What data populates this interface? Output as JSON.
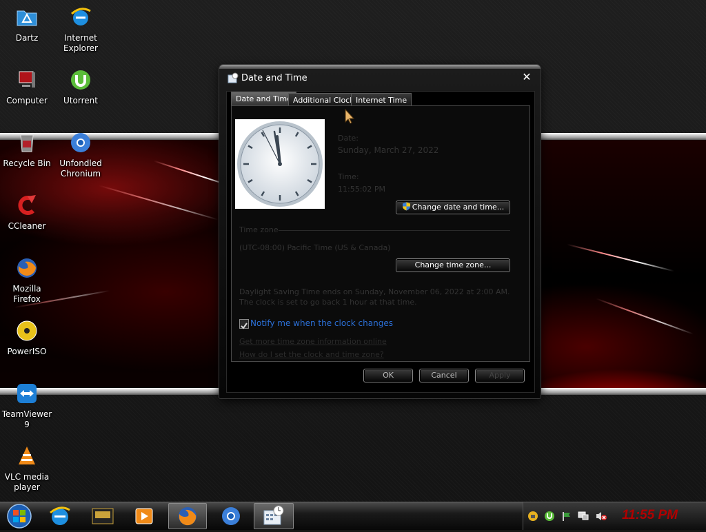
{
  "desktop_icons": [
    {
      "label": "Dartz",
      "icon": "dartz-folder-icon"
    },
    {
      "label": "Internet Explorer",
      "icon": "internet-explorer-icon"
    },
    {
      "label": "Computer",
      "icon": "computer-icon"
    },
    {
      "label": "Utorrent",
      "icon": "utorrent-icon"
    },
    {
      "label": "Recycle Bin",
      "icon": "recycle-bin-icon"
    },
    {
      "label": "Unfondled Chronium",
      "icon": "chromium-icon"
    },
    {
      "label": "CCleaner",
      "icon": "ccleaner-icon"
    },
    {
      "label": "Mozilla Firefox",
      "icon": "firefox-icon"
    },
    {
      "label": "PowerISO",
      "icon": "poweriso-icon"
    },
    {
      "label": "TeamViewer 9",
      "icon": "teamviewer-icon"
    },
    {
      "label": "VLC media player",
      "icon": "vlc-icon"
    }
  ],
  "dialog": {
    "title": "Date and Time",
    "close_label": "✕",
    "tabs": [
      {
        "label": "Date and Time",
        "active": true
      },
      {
        "label": "Additional Clocks",
        "active": false
      },
      {
        "label": "Internet Time",
        "active": false
      }
    ],
    "date_label": "Date:",
    "date_value": "Sunday, March 27, 2022",
    "time_label": "Time:",
    "time_value": "11:55:02 PM",
    "change_datetime_button": "Change date and time...",
    "timezone_header": "Time zone",
    "timezone_value": "(UTC-08:00) Pacific Time (US & Canada)",
    "change_timezone_button": "Change time zone...",
    "dst_notice": "Daylight Saving Time ends on Sunday, November 06, 2022 at 2:00 AM. The clock is set to go back 1 hour at that time.",
    "notify_checkbox_label": "Notify me when the clock changes",
    "notify_checked": true,
    "link_more_info": "Get more time zone information online",
    "link_how_to": "How do I set the clock and time zone?",
    "ok_button": "OK",
    "cancel_button": "Cancel",
    "apply_button": "Apply"
  },
  "taskbar": {
    "start_icon": "windows-start-orb-icon",
    "pinned": [
      "internet-explorer-icon",
      "game-app-icon",
      "media-player-icon",
      "firefox-icon",
      "chromium-icon",
      "date-time-app-icon"
    ],
    "tray_icons": [
      "network-icon",
      "utorrent-icon",
      "flag-icon",
      "display-icon",
      "volume-muted-icon"
    ],
    "clock": "11:55 PM"
  },
  "colors": {
    "clock_red": "#b00000",
    "link_blue": "#2b6fd6"
  }
}
